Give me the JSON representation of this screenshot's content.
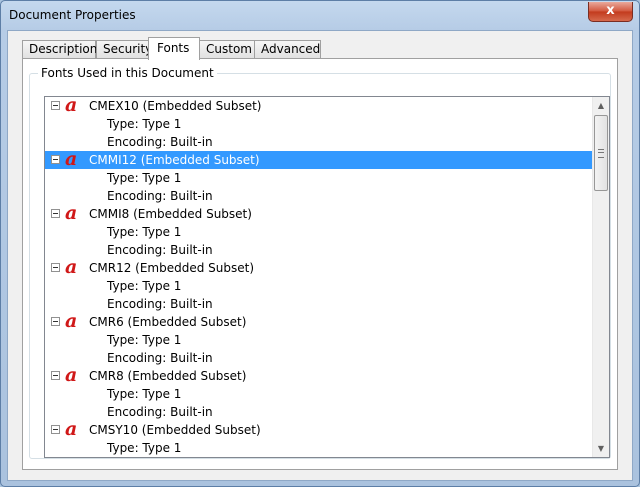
{
  "window": {
    "title": "Document Properties",
    "close_label": "x"
  },
  "tabs": [
    {
      "label": "Description",
      "active": false
    },
    {
      "label": "Security",
      "active": false
    },
    {
      "label": "Fonts",
      "active": true
    },
    {
      "label": "Custom",
      "active": false
    },
    {
      "label": "Advanced",
      "active": false
    }
  ],
  "group": {
    "label": "Fonts Used in this Document"
  },
  "icons": {
    "font_icon_glyph": "a",
    "font_icon_color": "#d01818",
    "scroll_up": "▲",
    "scroll_down": "▼"
  },
  "fonts": [
    {
      "name": "CMEX10 (Embedded Subset)",
      "type": "Type: Type 1",
      "encoding": "Encoding: Built-in",
      "selected": false
    },
    {
      "name": "CMMI12 (Embedded Subset)",
      "type": "Type: Type 1",
      "encoding": "Encoding: Built-in",
      "selected": true
    },
    {
      "name": "CMMI8 (Embedded Subset)",
      "type": "Type: Type 1",
      "encoding": "Encoding: Built-in",
      "selected": false
    },
    {
      "name": "CMR12 (Embedded Subset)",
      "type": "Type: Type 1",
      "encoding": "Encoding: Built-in",
      "selected": false
    },
    {
      "name": "CMR6 (Embedded Subset)",
      "type": "Type: Type 1",
      "encoding": "Encoding: Built-in",
      "selected": false
    },
    {
      "name": "CMR8 (Embedded Subset)",
      "type": "Type: Type 1",
      "encoding": "Encoding: Built-in",
      "selected": false
    },
    {
      "name": "CMSY10 (Embedded Subset)",
      "type": "Type: Type 1",
      "encoding": "",
      "selected": false
    }
  ]
}
